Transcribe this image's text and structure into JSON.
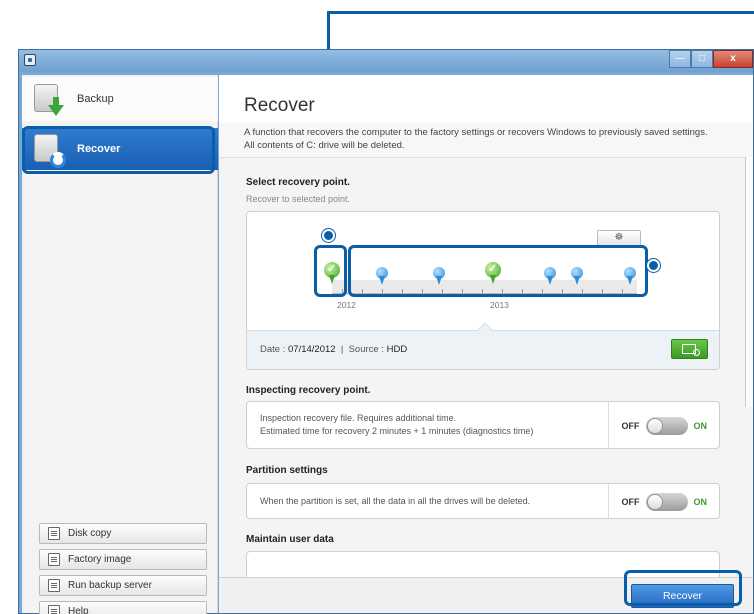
{
  "window": {
    "minimize_label": "—",
    "maximize_label": "□",
    "close_label": "x"
  },
  "sidebar": {
    "items": [
      {
        "label": "Backup"
      },
      {
        "label": "Recover"
      }
    ],
    "buttons": [
      {
        "label": "Disk copy"
      },
      {
        "label": "Factory image"
      },
      {
        "label": "Run backup server"
      },
      {
        "label": "Help"
      }
    ]
  },
  "main": {
    "title": "Recover",
    "description_line1": "A function that recovers the computer to the factory settings or recovers Windows to previously saved settings.",
    "description_line2": "All contents of C: drive will be deleted.",
    "recovery_point": {
      "title": "Select recovery point.",
      "subtitle": "Recover to selected point.",
      "years": [
        "2012",
        "2013"
      ],
      "date_label": "Date :",
      "date_value": "07/14/2012",
      "separator": "|",
      "source_label": "Source :",
      "source_value": "HDD"
    },
    "inspecting": {
      "title": "Inspecting recovery point.",
      "line1": "Inspection recovery file. Requires additional time.",
      "line2": "Estimated time for recovery 2 minutes + 1 minutes (diagnostics time)",
      "off_label": "OFF",
      "on_label": "ON"
    },
    "partition": {
      "title": "Partition settings",
      "text": "When the partition is set, all the data in all the drives will be deleted.",
      "off_label": "OFF",
      "on_label": "ON"
    },
    "maintain": {
      "title": "Maintain user data"
    },
    "recover_button": "Recover"
  },
  "colors": {
    "accent": "#1a5fb4",
    "annotation": "#0a5ea8",
    "on_green": "#3d9a27"
  }
}
